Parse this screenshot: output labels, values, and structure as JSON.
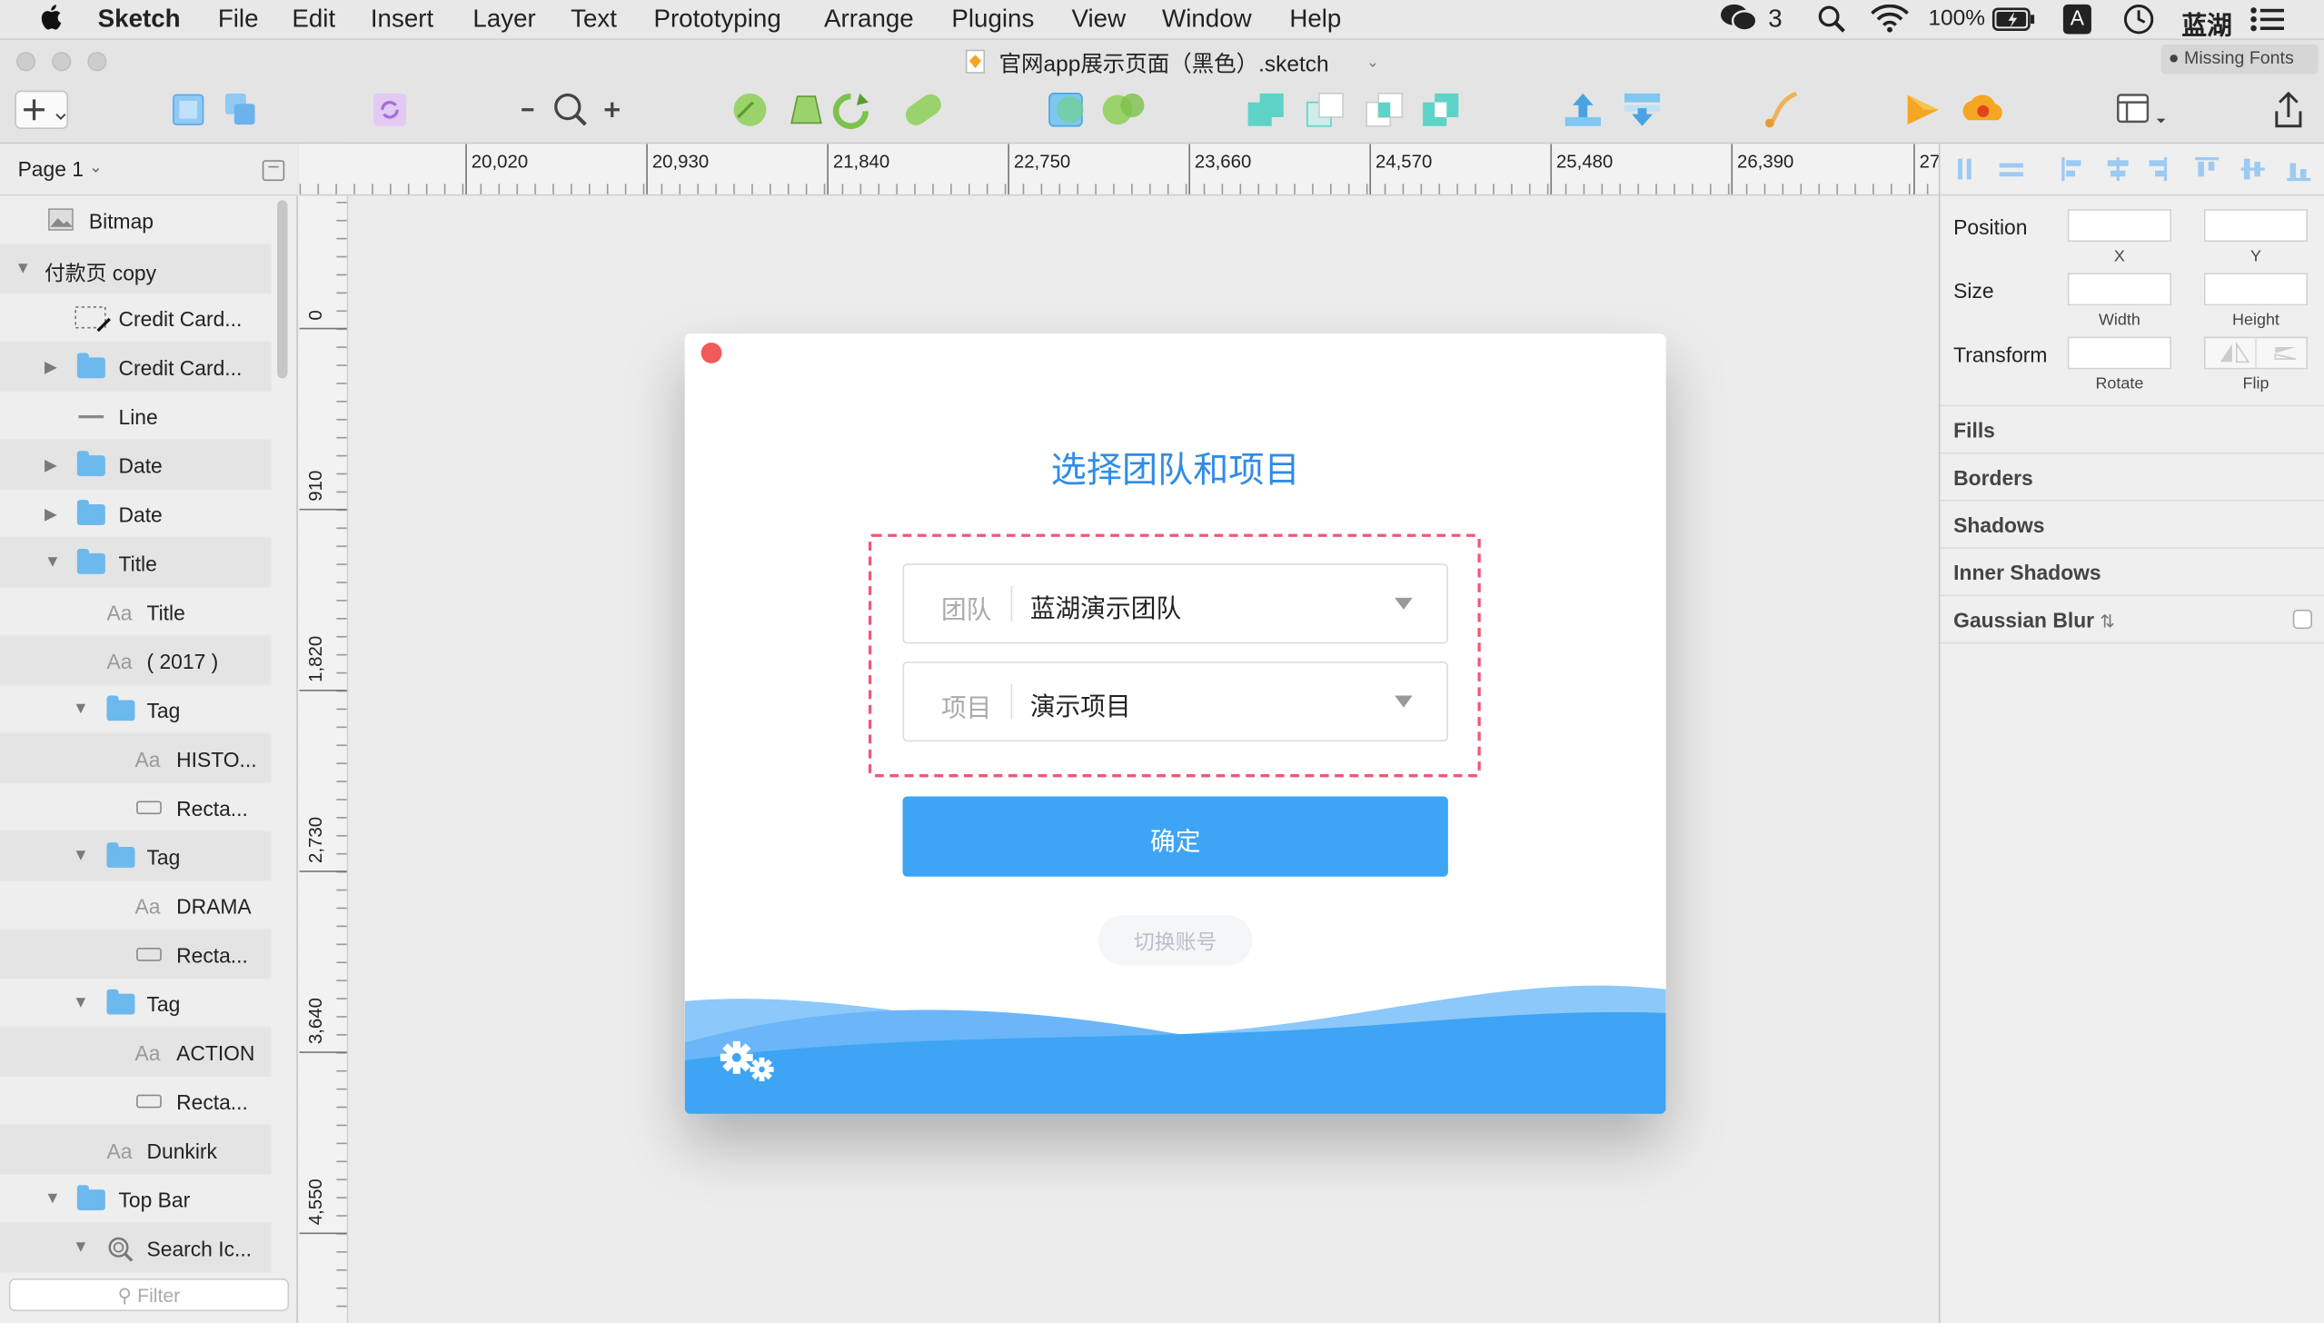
{
  "menubar": {
    "apple": "",
    "items": [
      "Sketch",
      "File",
      "Edit",
      "Insert",
      "Layer",
      "Text",
      "Prototyping",
      "Arrange",
      "Plugins",
      "View",
      "Window",
      "Help"
    ],
    "wechat_count": "3",
    "battery": "100%",
    "input_method": "A",
    "user": "蓝湖"
  },
  "window": {
    "title": "官网app展示页面（黑色）.sketch",
    "missing_fonts": "Missing Fonts"
  },
  "layers": {
    "page": "Page 1",
    "rows": [
      {
        "label": "Bitmap",
        "icon": "bitmap-icon"
      },
      {
        "label": "付款页 copy",
        "icon": "none"
      },
      {
        "label": "Credit Card...",
        "icon": "symbol-icon"
      },
      {
        "label": "Credit Card...",
        "icon": "folder-icon"
      },
      {
        "label": "Line",
        "icon": "line-icon"
      },
      {
        "label": "Date",
        "icon": "folder-icon"
      },
      {
        "label": "Date",
        "icon": "folder-icon"
      },
      {
        "label": "Title",
        "icon": "folder-icon"
      },
      {
        "label": "Title",
        "icon": "text-icon"
      },
      {
        "label": "( 2017 )",
        "icon": "text-icon"
      },
      {
        "label": "Tag",
        "icon": "folder-icon"
      },
      {
        "label": "HISTO...",
        "icon": "text-icon"
      },
      {
        "label": "Recta...",
        "icon": "rectangle-icon"
      },
      {
        "label": "Tag",
        "icon": "folder-icon"
      },
      {
        "label": "DRAMA",
        "icon": "text-icon"
      },
      {
        "label": "Recta...",
        "icon": "rectangle-icon"
      },
      {
        "label": "Tag",
        "icon": "folder-icon"
      },
      {
        "label": "ACTION",
        "icon": "text-icon"
      },
      {
        "label": "Recta...",
        "icon": "rectangle-icon"
      },
      {
        "label": "Dunkirk",
        "icon": "text-icon"
      },
      {
        "label": "Top Bar",
        "icon": "folder-icon"
      },
      {
        "label": "Search Ic...",
        "icon": "search-icon"
      }
    ],
    "text_icon_glyph": "Aa",
    "filter_placeholder": "Filter"
  },
  "rulers": {
    "top": [
      "20,020",
      "20,930",
      "21,840",
      "22,750",
      "23,660",
      "24,570",
      "25,480",
      "26,390",
      "27"
    ],
    "left": [
      "0",
      "910",
      "1,820",
      "2,730",
      "3,640",
      "4,550"
    ]
  },
  "dialog": {
    "title": "选择团队和项目",
    "team_label": "团队",
    "team_value": "蓝湖演示团队",
    "project_label": "项目",
    "project_value": "演示项目",
    "confirm": "确定",
    "switch_account": "切换账号",
    "accent": "#3ea4f4",
    "highlight": "#ee5878"
  },
  "inspector": {
    "position": "Position",
    "x": "X",
    "y": "Y",
    "size": "Size",
    "width": "Width",
    "height": "Height",
    "transform": "Transform",
    "rotate": "Rotate",
    "flip": "Flip",
    "sections": [
      "Fills",
      "Borders",
      "Shadows",
      "Inner Shadows",
      "Gaussian Blur"
    ]
  }
}
